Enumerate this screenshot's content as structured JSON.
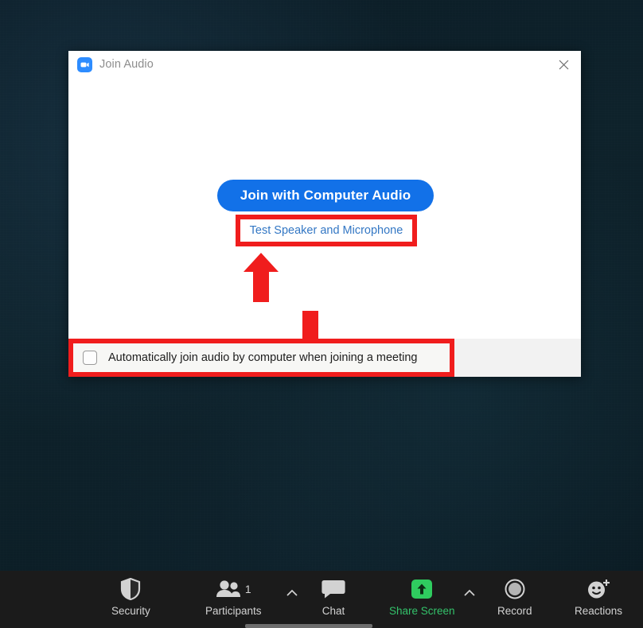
{
  "dialog": {
    "title": "Join Audio",
    "logo_icon": "zoom-video-icon",
    "close_icon": "close-icon",
    "join_button_label": "Join with Computer Audio",
    "test_link_label": "Test Speaker and Microphone",
    "checkbox_label": "Automatically join audio by computer when joining a meeting",
    "checkbox_checked": false
  },
  "annotations": {
    "color": "#f01d1d",
    "arrow_up_icon": "arrow-up-icon",
    "arrow_down_icon": "arrow-down-icon",
    "highlight_link": "Test Speaker and Microphone",
    "highlight_checkbox": "Automatically join audio by computer when joining a meeting"
  },
  "toolbar": {
    "background": "#1b1b1b",
    "items": [
      {
        "label": "Security",
        "icon": "shield-icon",
        "badge": "",
        "caret": false,
        "accent": "#d2d2d2"
      },
      {
        "label": "Participants",
        "icon": "people-icon",
        "badge": "1",
        "caret": true,
        "accent": "#d2d2d2"
      },
      {
        "label": "Chat",
        "icon": "chat-bubble-icon",
        "badge": "",
        "caret": false,
        "accent": "#d2d2d2"
      },
      {
        "label": "Share Screen",
        "icon": "share-screen-icon",
        "badge": "",
        "caret": true,
        "accent": "#33c26a"
      },
      {
        "label": "Record",
        "icon": "record-circle-icon",
        "badge": "",
        "caret": false,
        "accent": "#d2d2d2"
      },
      {
        "label": "Reactions",
        "icon": "reactions-smiley-icon",
        "badge": "",
        "caret": false,
        "accent": "#d2d2d2"
      }
    ]
  },
  "colors": {
    "accent_blue": "#1271e8",
    "link_blue": "#3377c4",
    "annotation_red": "#f01d1d",
    "share_green": "#2fcc5f",
    "desktop_background": "#0d1f28"
  }
}
